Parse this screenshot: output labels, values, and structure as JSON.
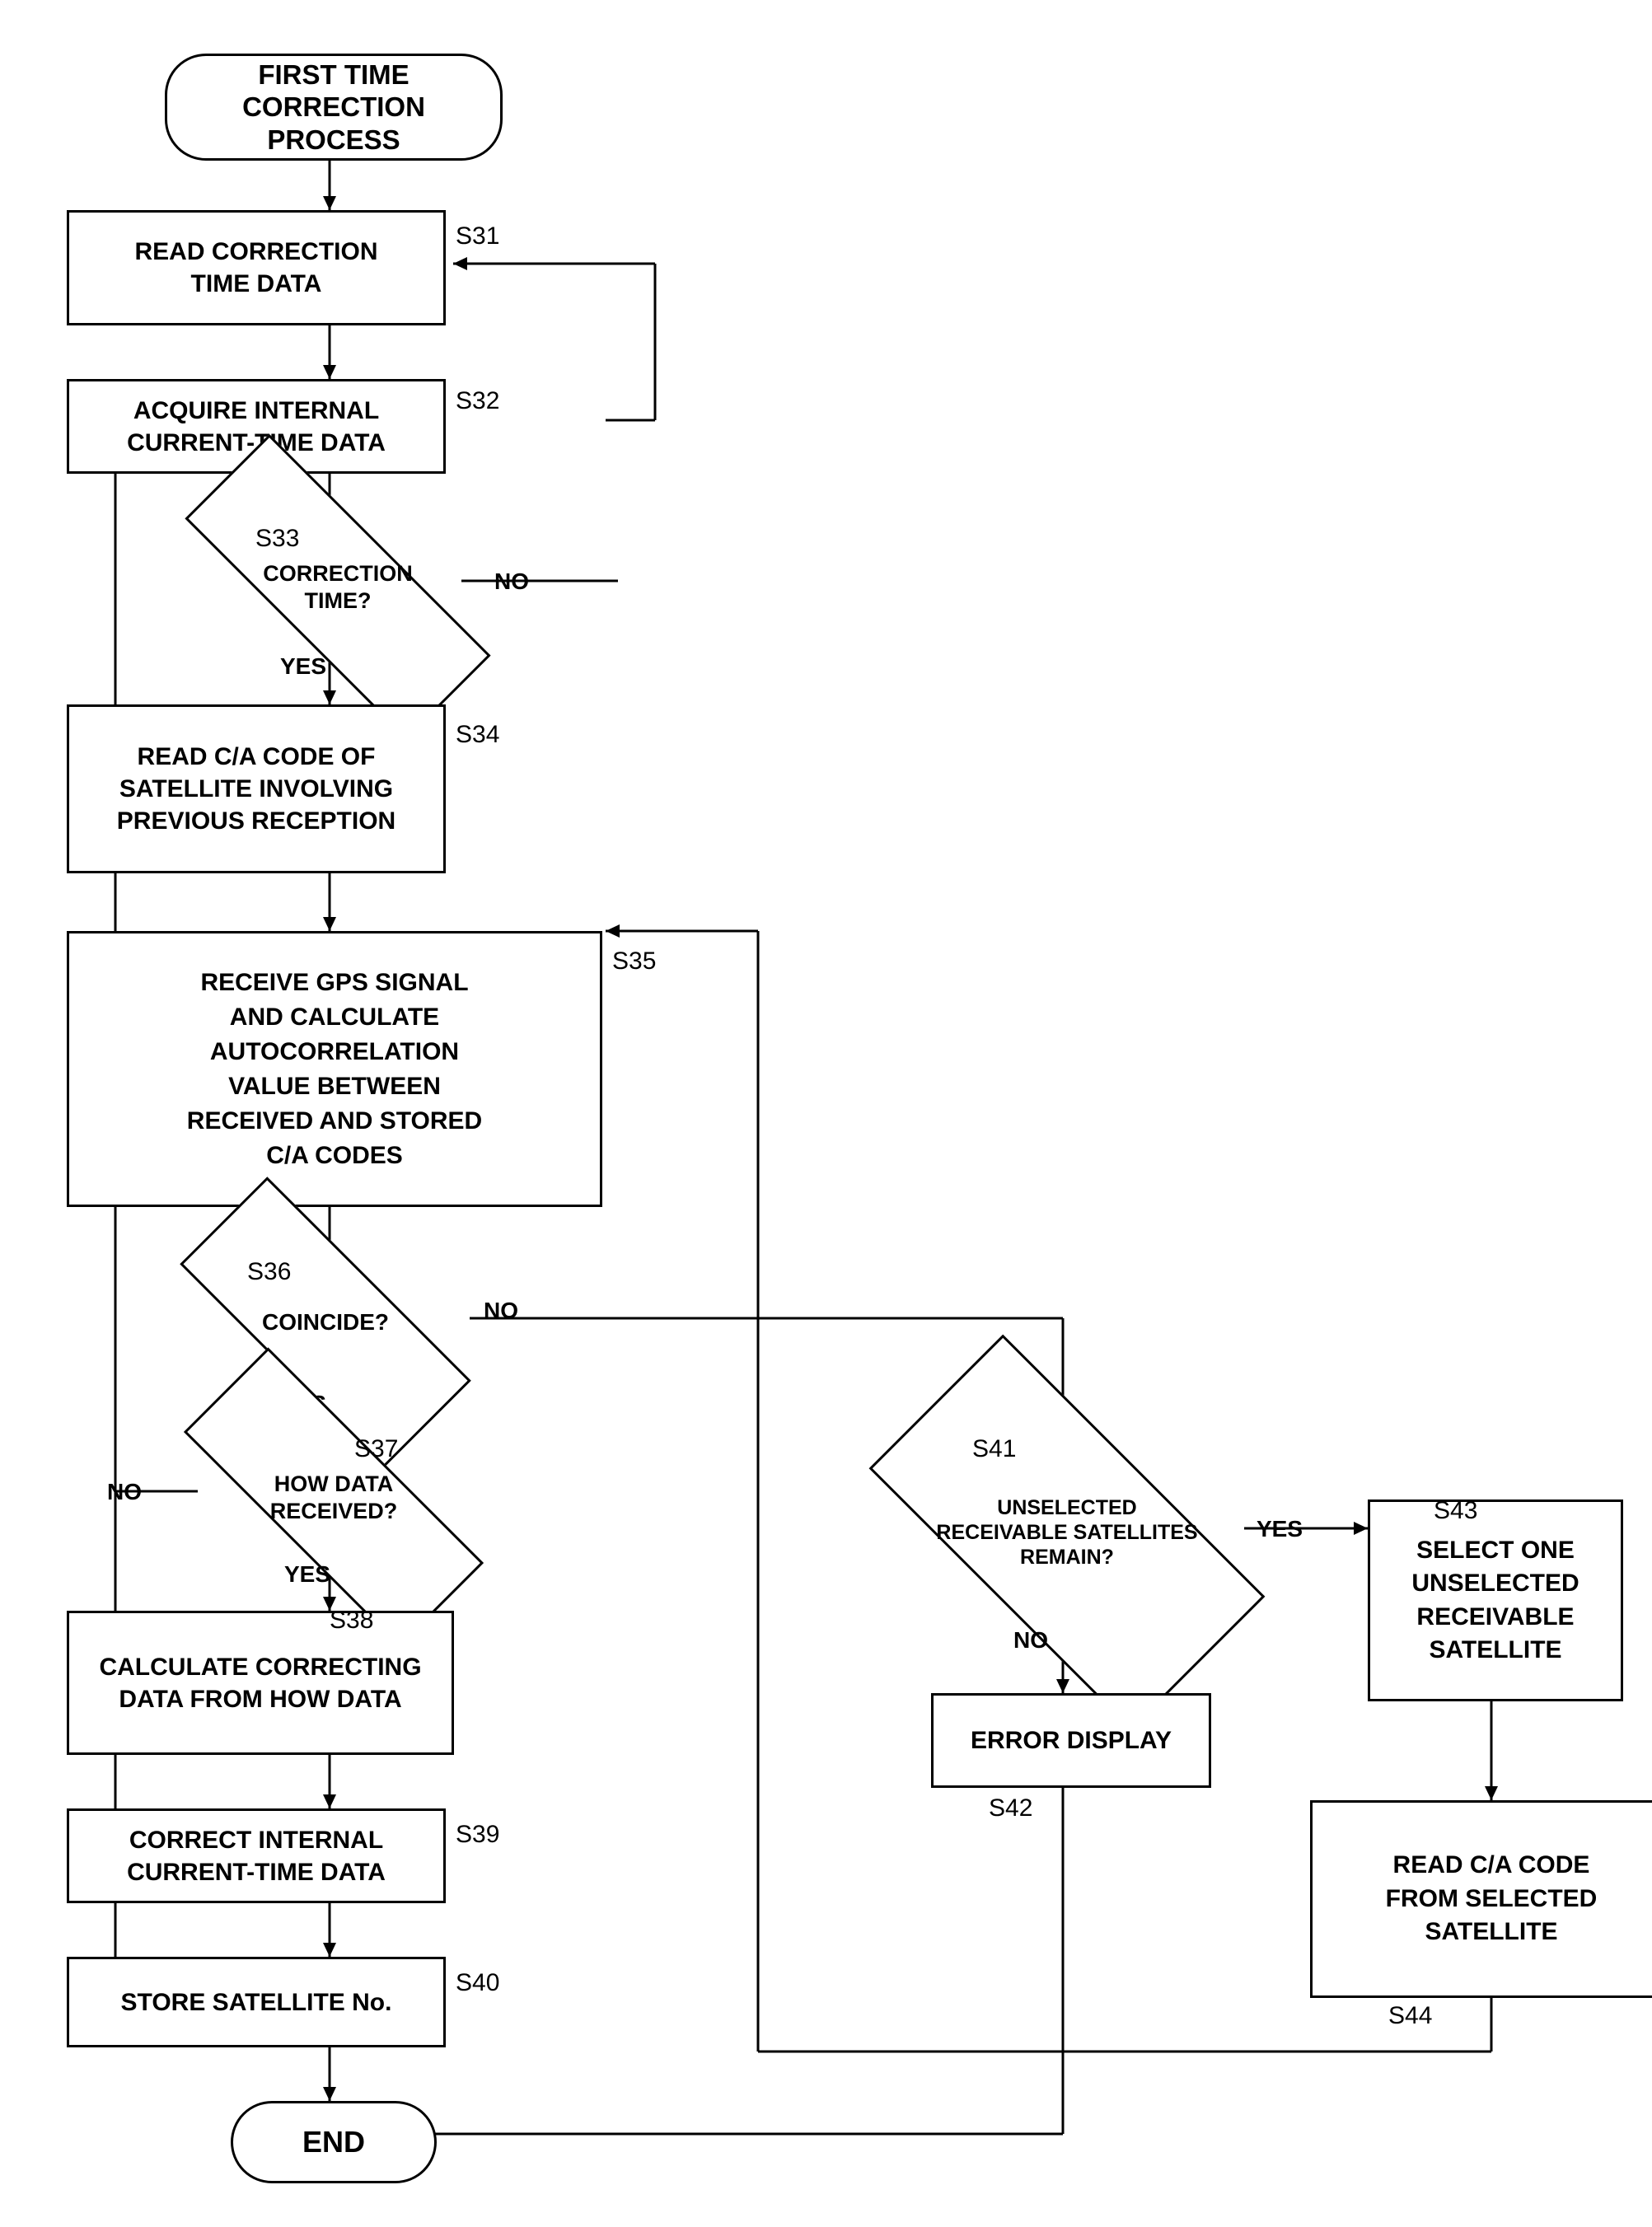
{
  "nodes": {
    "start": {
      "label": "FIRST TIME\nCORRECTION PROCESS"
    },
    "s31": {
      "label": "READ CORRECTION\nTIME DATA",
      "step": "S31"
    },
    "s32": {
      "label": "ACQUIRE INTERNAL\nCURRENT-TIME DATA",
      "step": "S32"
    },
    "s33": {
      "label": "CORRECTION\nTIME?",
      "step": "S33"
    },
    "s34": {
      "label": "READ C/A CODE OF\nSATELLITE INVOLVING\nPREVIOUS RECEPTION",
      "step": "S34"
    },
    "s35": {
      "label": "RECEIVE GPS SIGNAL\nAND CALCULATE\nAUTOCORRELATION\nVALUE BETWEEN\nRECEIVED AND STORED\nC/A CODES",
      "step": "S35"
    },
    "s36": {
      "label": "COINCIDE?",
      "step": "S36"
    },
    "s37": {
      "label": "HOW DATA\nRECEIVED?",
      "step": "S37"
    },
    "s38": {
      "label": "CALCULATE CORRECTING\nDATA FROM HOW DATA",
      "step": "S38"
    },
    "s39": {
      "label": "CORRECT INTERNAL\nCURRENT-TIME DATA",
      "step": "S39"
    },
    "s40": {
      "label": "STORE SATELLITE No.",
      "step": "S40"
    },
    "s41": {
      "label": "UNSELECTED\nRECEIVABLE SATELLITES\nREMAIN?",
      "step": "S41"
    },
    "s42": {
      "label": "ERROR DISPLAY",
      "step": "S42"
    },
    "s43": {
      "label": "SELECT ONE\nUNSELECTED\nRECEIVABLE\nSATELLITE",
      "step": "S43"
    },
    "s44": {
      "label": "READ C/A CODE\nFROM SELECTED\nSATELLITE",
      "step": "S44"
    },
    "end": {
      "label": "END"
    }
  },
  "yes": "YES",
  "no": "NO"
}
